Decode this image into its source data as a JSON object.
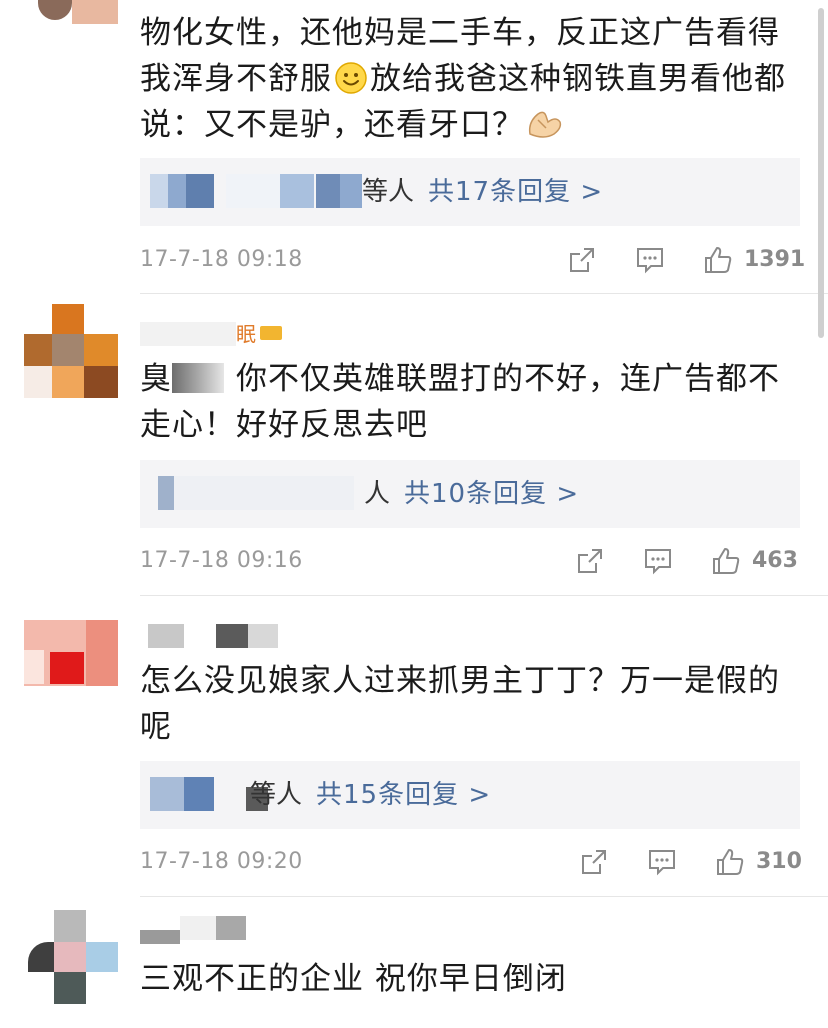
{
  "comments": [
    {
      "text_parts": [
        "物化女性，还他妈是二手车，反正这广告看得我浑身不舒服",
        "放给我爸这种钢铁直男看他都说：又不是驴，还看牙口？"
      ],
      "emoji": [
        "smile-emoji",
        "clap-hands-emoji"
      ],
      "reply_who": "等人",
      "reply_link": "共17条回复 >",
      "timestamp": "17-7-18 09:18",
      "likes": "1391"
    },
    {
      "username_partial": "眠",
      "text": "你不仅英雄联盟打的不好，连广告都不走心！好好反思去吧",
      "text_prefix_partial": "臭",
      "reply_who": "人",
      "reply_link": "共10条回复 >",
      "timestamp": "17-7-18 09:16",
      "likes": "463"
    },
    {
      "text": "怎么没见娘家人过来抓男主丁丁？万一是假的呢",
      "reply_who": "等人",
      "reply_link": "共15条回复 >",
      "timestamp": "17-7-18 09:20",
      "likes": "310"
    },
    {
      "text": "三观不正的企业 祝你早日倒闭"
    }
  ],
  "icons": {
    "share": "share-icon",
    "comment": "comment-icon",
    "like": "thumbs-up-icon"
  },
  "colors": {
    "link": "#4a6b9a",
    "timestamp": "#9a9a9a",
    "reply_bg": "#f4f4f6"
  }
}
